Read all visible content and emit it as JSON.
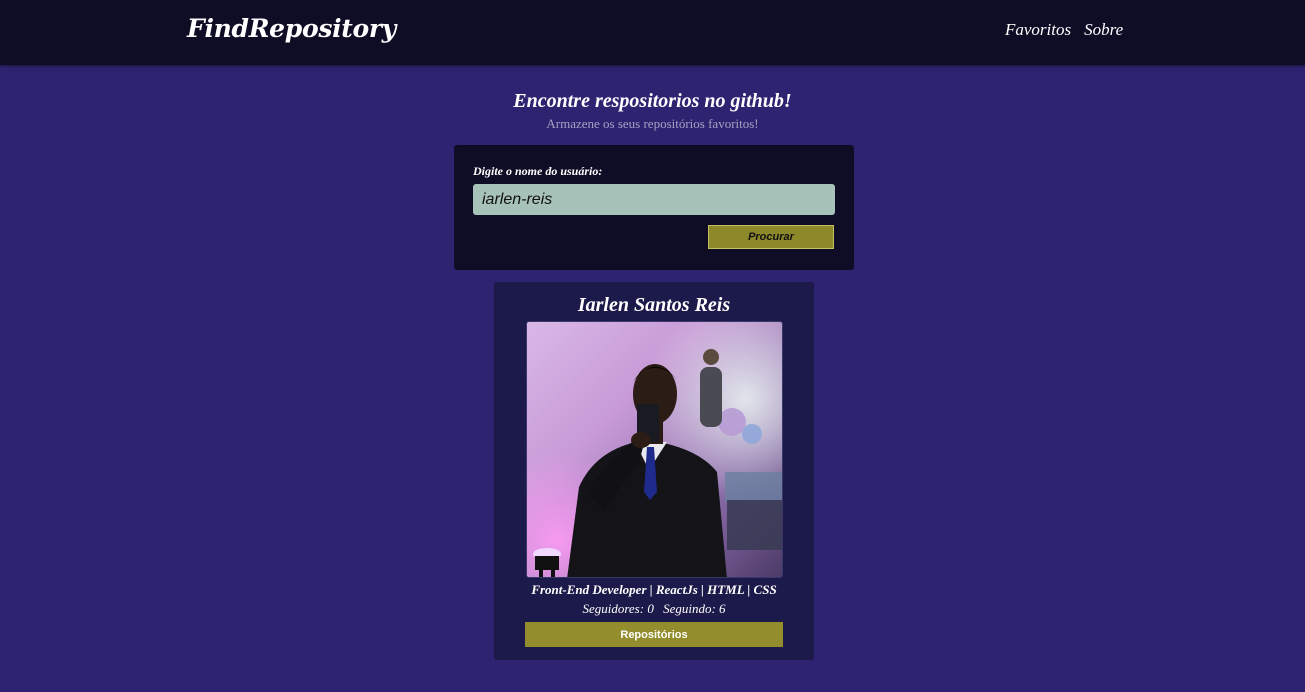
{
  "navbar": {
    "logo": "FindRepository",
    "links": [
      "Favoritos",
      "Sobre"
    ]
  },
  "hero": {
    "title": "Encontre respositorios no github!",
    "subtitle": "Armazene os seus repositórios favoritos!"
  },
  "search": {
    "label": "Digite o nome do usuário:",
    "value": "iarlen-reis",
    "button_label": "Procurar"
  },
  "profile": {
    "name": "Iarlen Santos Reis",
    "bio": "Front-End Developer | ReactJs | HTML | CSS",
    "followers_label": "Seguidores: 0",
    "following_label": "Seguindo: 6",
    "repos_button_label": "Repositórios"
  },
  "colors": {
    "background": "#2d2370",
    "navbar": "#0f0d26",
    "panel": "#0f0d26",
    "card": "#1c1a4a",
    "input": "#a7c2b9",
    "button": "#8d882a"
  }
}
